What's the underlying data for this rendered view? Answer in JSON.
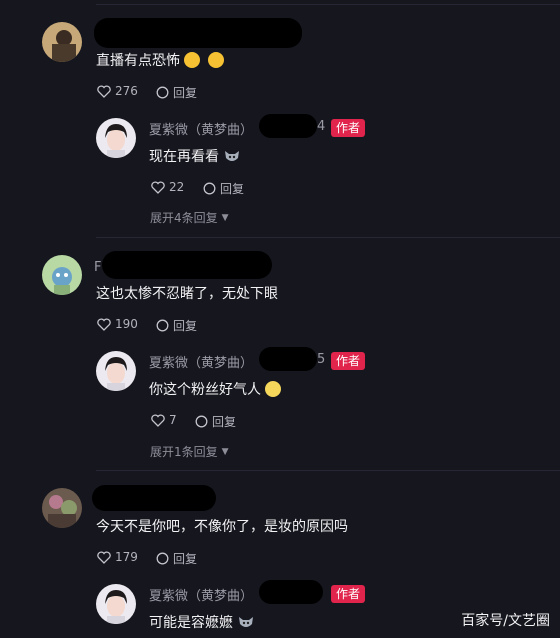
{
  "threads": [
    {
      "comment": {
        "text": "直播有点恐怖",
        "emojis": [
          "laugh-cry",
          "laugh-cry"
        ],
        "likes": "276",
        "reply_label": "回复"
      },
      "reply": {
        "author": "夏紫微（黄梦曲）",
        "name_tail": "4",
        "badge": "作者",
        "text": "现在再看看",
        "emoji": "wolf-face",
        "likes": "22",
        "reply_label": "回复"
      },
      "expand_label": "展开4条回复"
    },
    {
      "comment": {
        "name_head": "F",
        "text": "这也太惨不忍睹了，无处下眼",
        "likes": "190",
        "reply_label": "回复"
      },
      "reply": {
        "author": "夏紫微（黄梦曲）",
        "name_tail": "5",
        "badge": "作者",
        "text": "你这个粉丝好气人",
        "emoji": "flushed-face",
        "likes": "7",
        "reply_label": "回复"
      },
      "expand_label": "展开1条回复"
    },
    {
      "comment": {
        "text": "今天不是你吧，不像你了，是妆的原因吗",
        "likes": "179",
        "reply_label": "回复"
      },
      "reply": {
        "author": "夏紫微（黄梦曲）",
        "badge": "作者",
        "text": "可能是容嬷嬷",
        "emoji": "wolf-face"
      }
    }
  ],
  "watermark": "百家号/文艺圈",
  "colors": {
    "background": "#15161e",
    "author_badge": "#e0244b"
  }
}
